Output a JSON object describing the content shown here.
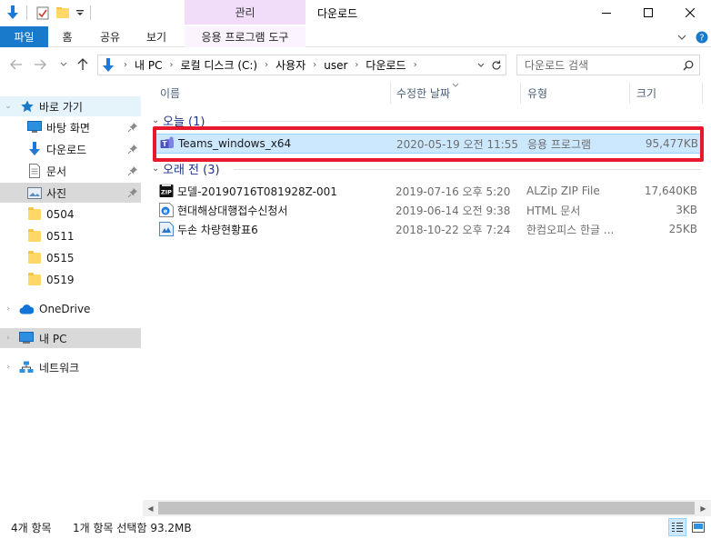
{
  "window": {
    "title": "다운로드",
    "context_tab_label": "관리",
    "minimize_label": "—",
    "maximize_label": "☐",
    "close_label": "✕"
  },
  "ribbon": {
    "tabs": [
      {
        "label": "파일"
      },
      {
        "label": "홈"
      },
      {
        "label": "공유"
      },
      {
        "label": "보기"
      },
      {
        "label": "응용 프로그램 도구"
      }
    ],
    "file_tab_color": "#1979ca",
    "context_color": "#f1dcfa"
  },
  "address": {
    "breadcrumbs": [
      "내 PC",
      "로컬 디스크 (C:)",
      "사용자",
      "user",
      "다운로드"
    ],
    "search_placeholder": "다운로드 검색"
  },
  "nav": {
    "quick_access": "바로 가기",
    "items": [
      {
        "label": "바탕 화면",
        "icon": "desktop-icon",
        "pinned": true
      },
      {
        "label": "다운로드",
        "icon": "download-icon",
        "pinned": true
      },
      {
        "label": "문서",
        "icon": "document-icon",
        "pinned": true
      },
      {
        "label": "사진",
        "icon": "pictures-icon",
        "pinned": true
      },
      {
        "label": "0504",
        "icon": "folder-icon",
        "pinned": false
      },
      {
        "label": "0511",
        "icon": "folder-icon",
        "pinned": false
      },
      {
        "label": "0515",
        "icon": "folder-icon",
        "pinned": false
      },
      {
        "label": "0519",
        "icon": "folder-icon",
        "pinned": false
      }
    ],
    "onedrive": "OneDrive",
    "this_pc": "내 PC",
    "network": "네트워크"
  },
  "columns": {
    "name": "이름",
    "modified": "수정한 날짜",
    "type": "유형",
    "size": "크기"
  },
  "groups": [
    {
      "header": "오늘 (1)",
      "files": [
        {
          "name": "Teams_windows_x64",
          "modified": "2020-05-19 오전 11:55",
          "type": "응용 프로그램",
          "size": "95,477KB",
          "icon": "teams-icon",
          "selected": true
        }
      ]
    },
    {
      "header": "오래 전 (3)",
      "files": [
        {
          "name": "모델-20190716T081928Z-001",
          "modified": "2019-07-16 오후 5:20",
          "type": "ALZip ZIP File",
          "size": "17,640KB",
          "icon": "zip-icon",
          "selected": false
        },
        {
          "name": "현대해상대행접수신청서",
          "modified": "2019-06-14 오전 9:38",
          "type": "HTML 문서",
          "size": "3KB",
          "icon": "html-icon",
          "selected": false
        },
        {
          "name": "두손 차량현황표6",
          "modified": "2018-10-22 오후 7:24",
          "type": "한컴오피스 한글 ...",
          "size": "25KB",
          "icon": "hwp-icon",
          "selected": false
        }
      ]
    }
  ],
  "status": {
    "item_count": "4개 항목",
    "selection": "1개 항목 선택함 93.2MB"
  }
}
